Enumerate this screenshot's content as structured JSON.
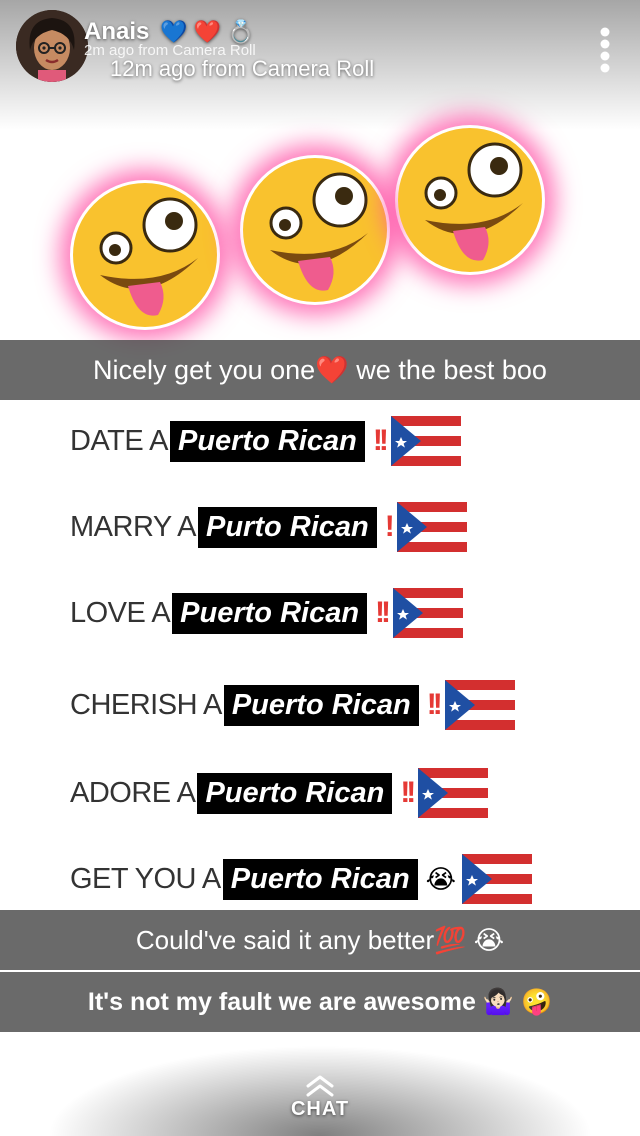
{
  "header": {
    "username": "Anais",
    "username_emojis": "💙 ❤️ 💍",
    "previous_meta": "2m ago from Camera Roll",
    "meta": "12m ago from Camera Roll"
  },
  "captions": {
    "top": "Nicely get you one❤️ we the best boo",
    "middle": "Could've said it any better💯 😭",
    "bottom": "It's not my fault we are awesome 🤷🏻‍♀️ 🤪"
  },
  "lines": [
    {
      "lead": "DATE A",
      "boxed": "Puerto Rican",
      "suffix": "!!"
    },
    {
      "lead": "MARRY A",
      "boxed": "Purto Rican",
      "suffix": "!"
    },
    {
      "lead": "LOVE A",
      "boxed": "Puerto Rican",
      "suffix": "!!"
    },
    {
      "lead": "CHERISH A",
      "boxed": "Puerto Rican",
      "suffix": "!!"
    },
    {
      "lead": "ADORE A",
      "boxed": "Puerto Rican",
      "suffix": "!!"
    },
    {
      "lead": "GET YOU A",
      "boxed": "Puerto Rican",
      "suffix": "😭"
    }
  ],
  "footer": {
    "chat_label": "CHAT"
  },
  "icons": {
    "menu": "more-vertical-icon",
    "chat_arrow": "chevron-up-icon",
    "flag": "puerto-rico-flag-icon",
    "zany_face": "zany-face-icon"
  },
  "colors": {
    "caption_bar": "#505050",
    "emoji_glow": "#ff46a0",
    "bang_red": "#e53935",
    "flag_red": "#d32f2f",
    "flag_blue": "#1f4fa3"
  }
}
